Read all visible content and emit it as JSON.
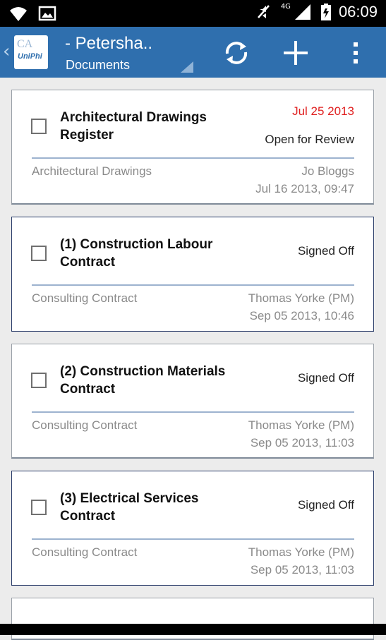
{
  "status_bar": {
    "time": "06:09",
    "network_type": "4G",
    "icons": [
      "wifi-icon",
      "image-icon",
      "mute-icon",
      "signal-icon",
      "battery-icon"
    ]
  },
  "action_bar": {
    "project": "- Petersha..",
    "subtitle": "Documents",
    "logo_text": "UniPhi",
    "logo_mark": "CA",
    "color": "#2f6fae",
    "actions": [
      "refresh-icon",
      "add-icon",
      "overflow-menu-icon"
    ]
  },
  "documents": [
    {
      "title": "Architectural Drawings Register",
      "due_date": "Jul 25 2013",
      "status": "Open for Review",
      "type": "Architectural Drawings",
      "author": "Jo Bloggs",
      "modified": "Jul 16 2013, 09:47"
    },
    {
      "title": "(1) Construction Labour Contract",
      "status": "Signed Off",
      "type": "Consulting Contract",
      "author": "Thomas Yorke (PM)",
      "modified": "Sep 05 2013, 10:46"
    },
    {
      "title": "(2) Construction Materials Contract",
      "status": "Signed Off",
      "type": "Consulting Contract",
      "author": "Thomas Yorke (PM)",
      "modified": "Sep 05 2013, 11:03"
    },
    {
      "title": "(3) Electrical Services Contract",
      "status": "Signed Off",
      "type": "Consulting Contract",
      "author": "Thomas Yorke (PM)",
      "modified": "Sep 05 2013, 11:03"
    }
  ],
  "colors": {
    "accent": "#2f6fae",
    "due_date": "#e02020",
    "divider": "#9db3cf"
  }
}
